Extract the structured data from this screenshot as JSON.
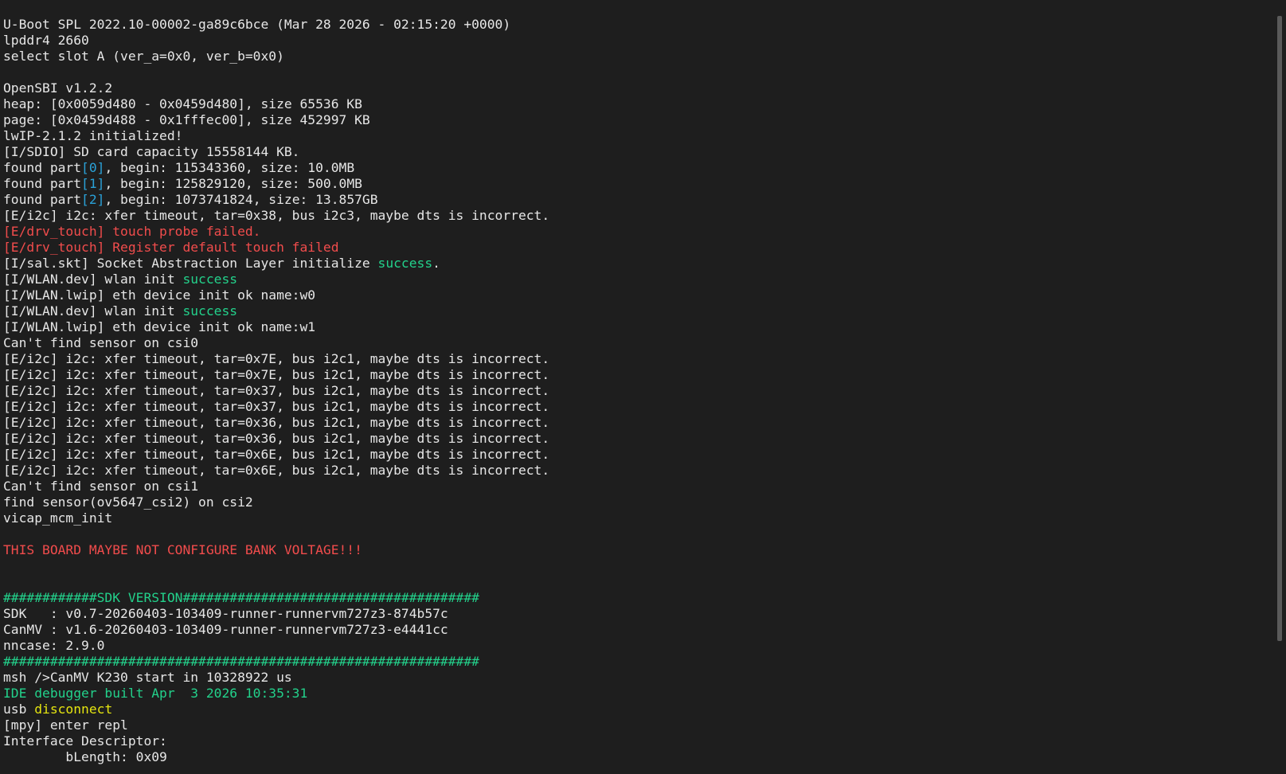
{
  "terminal": {
    "lines": [
      [
        {
          "t": "U-Boot SPL 2022.10-00002-ga89c6bce (Mar 28 2026 - 02:15:20 +0000)",
          "c": "normal"
        }
      ],
      [
        {
          "t": "lpddr4 2660",
          "c": "normal"
        }
      ],
      [
        {
          "t": "select slot A (ver_a=0x0, ver_b=0x0)",
          "c": "normal"
        }
      ],
      [
        {
          "t": "",
          "c": "normal"
        }
      ],
      [
        {
          "t": "OpenSBI v1.2.2",
          "c": "normal"
        }
      ],
      [
        {
          "t": "heap: [0x0059d480 - 0x0459d480], size 65536 KB",
          "c": "normal"
        }
      ],
      [
        {
          "t": "page: [0x0459d488 - 0x1fffec00], size 452997 KB",
          "c": "normal"
        }
      ],
      [
        {
          "t": "lwIP-2.1.2 initialized!",
          "c": "normal"
        }
      ],
      [
        {
          "t": "[I/SDIO] SD card capacity 15558144 KB.",
          "c": "normal"
        }
      ],
      [
        {
          "t": "found part",
          "c": "normal"
        },
        {
          "t": "[0]",
          "c": "blue"
        },
        {
          "t": ", begin: 115343360, size: 10.0MB",
          "c": "normal"
        }
      ],
      [
        {
          "t": "found part",
          "c": "normal"
        },
        {
          "t": "[1]",
          "c": "blue"
        },
        {
          "t": ", begin: 125829120, size: 500.0MB",
          "c": "normal"
        }
      ],
      [
        {
          "t": "found part",
          "c": "normal"
        },
        {
          "t": "[2]",
          "c": "blue"
        },
        {
          "t": ", begin: 1073741824, size: 13.857GB",
          "c": "normal"
        }
      ],
      [
        {
          "t": "[E/i2c] i2c: xfer timeout, tar=0x38, bus i2c3, maybe dts is incorrect.",
          "c": "normal"
        }
      ],
      [
        {
          "t": "[E/drv_touch] touch probe failed.",
          "c": "red"
        }
      ],
      [
        {
          "t": "[E/drv_touch] Register default touch failed",
          "c": "red"
        }
      ],
      [
        {
          "t": "[I/sal.skt] Socket Abstraction Layer initialize ",
          "c": "normal"
        },
        {
          "t": "success",
          "c": "green"
        },
        {
          "t": ".",
          "c": "normal"
        }
      ],
      [
        {
          "t": "[I/WLAN.dev] wlan init ",
          "c": "normal"
        },
        {
          "t": "success",
          "c": "green"
        }
      ],
      [
        {
          "t": "[I/WLAN.lwip] eth device init ok name:w0",
          "c": "normal"
        }
      ],
      [
        {
          "t": "[I/WLAN.dev] wlan init ",
          "c": "normal"
        },
        {
          "t": "success",
          "c": "green"
        }
      ],
      [
        {
          "t": "[I/WLAN.lwip] eth device init ok name:w1",
          "c": "normal"
        }
      ],
      [
        {
          "t": "Can't find sensor on csi0",
          "c": "normal"
        }
      ],
      [
        {
          "t": "[E/i2c] i2c: xfer timeout, tar=0x7E, bus i2c1, maybe dts is incorrect.",
          "c": "normal"
        }
      ],
      [
        {
          "t": "[E/i2c] i2c: xfer timeout, tar=0x7E, bus i2c1, maybe dts is incorrect.",
          "c": "normal"
        }
      ],
      [
        {
          "t": "[E/i2c] i2c: xfer timeout, tar=0x37, bus i2c1, maybe dts is incorrect.",
          "c": "normal"
        }
      ],
      [
        {
          "t": "[E/i2c] i2c: xfer timeout, tar=0x37, bus i2c1, maybe dts is incorrect.",
          "c": "normal"
        }
      ],
      [
        {
          "t": "[E/i2c] i2c: xfer timeout, tar=0x36, bus i2c1, maybe dts is incorrect.",
          "c": "normal"
        }
      ],
      [
        {
          "t": "[E/i2c] i2c: xfer timeout, tar=0x36, bus i2c1, maybe dts is incorrect.",
          "c": "normal"
        }
      ],
      [
        {
          "t": "[E/i2c] i2c: xfer timeout, tar=0x6E, bus i2c1, maybe dts is incorrect.",
          "c": "normal"
        }
      ],
      [
        {
          "t": "[E/i2c] i2c: xfer timeout, tar=0x6E, bus i2c1, maybe dts is incorrect.",
          "c": "normal"
        }
      ],
      [
        {
          "t": "Can't find sensor on csi1",
          "c": "normal"
        }
      ],
      [
        {
          "t": "find sensor(ov5647_csi2) on csi2",
          "c": "normal"
        }
      ],
      [
        {
          "t": "vicap_mcm_init",
          "c": "normal"
        }
      ],
      [
        {
          "t": "",
          "c": "normal"
        }
      ],
      [
        {
          "t": "THIS BOARD MAYBE NOT CONFIGURE BANK VOLTAGE!!!",
          "c": "red"
        }
      ],
      [
        {
          "t": "",
          "c": "normal"
        }
      ],
      [
        {
          "t": "",
          "c": "normal"
        }
      ],
      [
        {
          "t": "############SDK VERSION######################################",
          "c": "green"
        }
      ],
      [
        {
          "t": "SDK   : v0.7-20260403-103409-runner-runnervm727z3-874b57c",
          "c": "normal"
        }
      ],
      [
        {
          "t": "CanMV : v1.6-20260403-103409-runner-runnervm727z3-e4441cc",
          "c": "normal"
        }
      ],
      [
        {
          "t": "nncase: 2.9.0",
          "c": "normal"
        }
      ],
      [
        {
          "t": "#############################################################",
          "c": "green"
        }
      ],
      [
        {
          "t": "msh />CanMV K230 start in 10328922 us",
          "c": "normal"
        }
      ],
      [
        {
          "t": "IDE debugger built Apr  3 2026 10:35:31",
          "c": "green"
        }
      ],
      [
        {
          "t": "usb ",
          "c": "normal"
        },
        {
          "t": "disconnect",
          "c": "yellow"
        }
      ],
      [
        {
          "t": "[mpy] enter repl",
          "c": "normal"
        }
      ],
      [
        {
          "t": "Interface Descriptor:",
          "c": "normal"
        }
      ],
      [
        {
          "t": "        bLength: 0x09",
          "c": "normal"
        }
      ]
    ]
  },
  "colors": {
    "background": "#1e1e1e",
    "normal": "#e6e6e6",
    "red": "#f14c4c",
    "green": "#23d18b",
    "blue": "#2aa1d7",
    "yellow": "#e5e510",
    "scrollbar_thumb": "#5a5a5a"
  }
}
